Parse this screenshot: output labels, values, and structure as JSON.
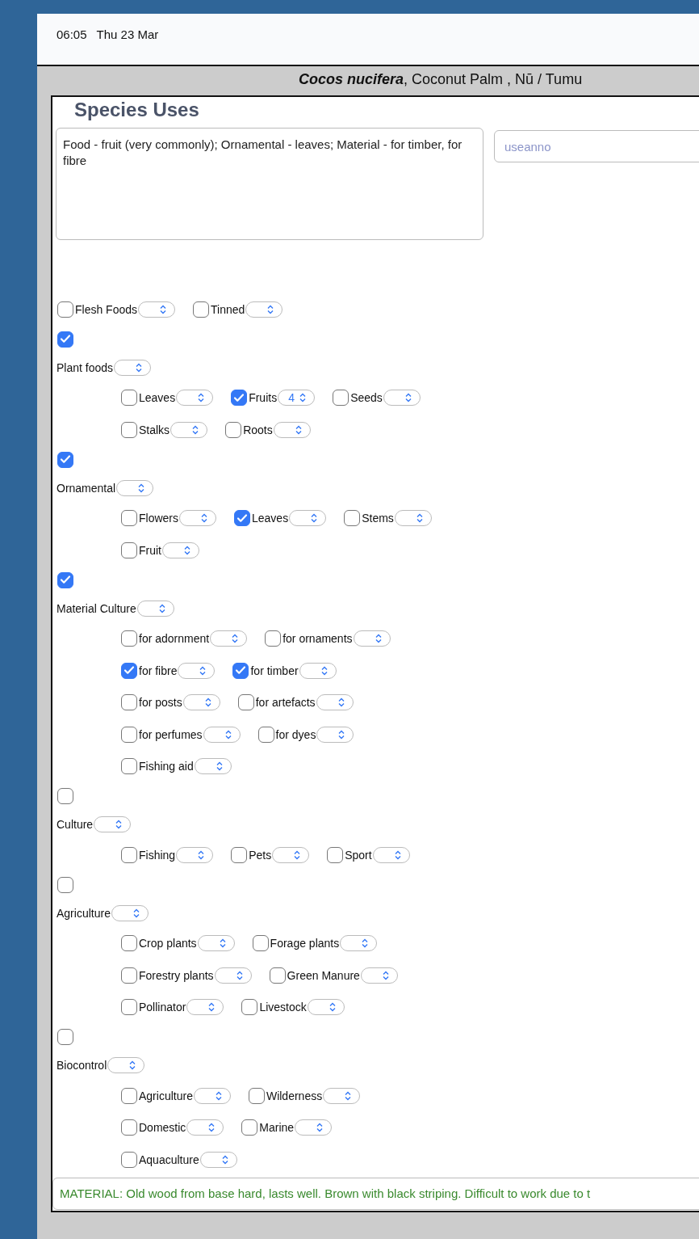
{
  "status_bar": {
    "time": "06:05",
    "date": "Thu 23 Mar"
  },
  "header": {
    "title": "**Cocos nucifera**, Coconut Palm , Nū / Tumu"
  },
  "section_title": "Species Uses",
  "uses_text": "Food - fruit (very commonly); Ornamental - leaves; Material - for timber, for fibre",
  "annotation_field": {
    "placeholder": "useanno"
  },
  "top_items": [
    {
      "label": "Flesh Foods",
      "checked": false
    },
    {
      "label": "Tinned",
      "checked": false
    }
  ],
  "categories": [
    {
      "label": "Plant foods",
      "checked": true,
      "rows": [
        [
          {
            "label": "Leaves",
            "checked": false
          },
          {
            "label": "Fruits",
            "checked": true,
            "value": "4"
          },
          {
            "label": "Seeds",
            "checked": false
          }
        ],
        [
          {
            "label": "Stalks",
            "checked": false
          },
          {
            "label": "Roots",
            "checked": false
          }
        ]
      ]
    },
    {
      "label": "Ornamental",
      "checked": true,
      "rows": [
        [
          {
            "label": "Flowers",
            "checked": false
          },
          {
            "label": "Leaves",
            "checked": true
          },
          {
            "label": "Stems",
            "checked": false
          }
        ],
        [
          {
            "label": "Fruit",
            "checked": false
          }
        ]
      ]
    },
    {
      "label": "Material Culture",
      "checked": true,
      "rows": [
        [
          {
            "label": "for adornment",
            "checked": false
          },
          {
            "label": "for ornaments",
            "checked": false
          }
        ],
        [
          {
            "label": "for fibre",
            "checked": true
          },
          {
            "label": "for timber",
            "checked": true
          }
        ],
        [
          {
            "label": "for posts",
            "checked": false
          },
          {
            "label": "for artefacts",
            "checked": false
          }
        ],
        [
          {
            "label": "for perfumes",
            "checked": false
          },
          {
            "label": "for dyes",
            "checked": false
          }
        ],
        [
          {
            "label": "Fishing aid",
            "checked": false
          }
        ]
      ]
    },
    {
      "label": "Culture",
      "checked": false,
      "rows": [
        [
          {
            "label": "Fishing",
            "checked": false
          },
          {
            "label": "Pets",
            "checked": false
          },
          {
            "label": "Sport",
            "checked": false
          }
        ]
      ]
    },
    {
      "label": "Agriculture",
      "checked": false,
      "rows": [
        [
          {
            "label": "Crop plants",
            "checked": false
          },
          {
            "label": "Forage plants",
            "checked": false
          }
        ],
        [
          {
            "label": "Forestry plants",
            "checked": false
          },
          {
            "label": "Green Manure",
            "checked": false
          }
        ],
        [
          {
            "label": "Pollinator",
            "checked": false
          },
          {
            "label": "Livestock",
            "checked": false
          }
        ]
      ]
    },
    {
      "label": "Biocontrol",
      "checked": false,
      "rows": [
        [
          {
            "label": "Agriculture",
            "checked": false
          },
          {
            "label": "Wilderness",
            "checked": false
          }
        ],
        [
          {
            "label": "Domestic",
            "checked": false
          },
          {
            "label": "Marine",
            "checked": false
          }
        ],
        [
          {
            "label": "Aquaculture",
            "checked": false
          }
        ]
      ]
    }
  ],
  "notes": "MATERIAL: Old wood from base hard, lasts well. Brown with black striping. Difficult to work due to t"
}
